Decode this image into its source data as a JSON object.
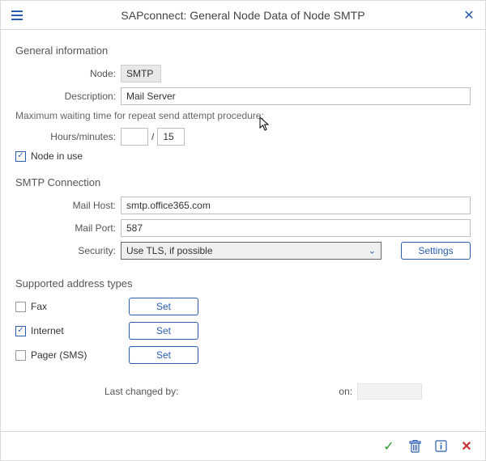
{
  "titlebar": {
    "title": "SAPconnect: General Node Data of Node SMTP"
  },
  "general": {
    "heading": "General information",
    "labels": {
      "node": "Node:",
      "description": "Description:",
      "wait_note": "Maximum waiting time for repeat send attempt procedure:",
      "hours_minutes": "Hours/minutes:",
      "separator": "/",
      "node_in_use": "Node in use"
    },
    "values": {
      "node": "SMTP",
      "description": "Mail Server",
      "hours": "",
      "minutes": "15"
    },
    "node_in_use_checked": true
  },
  "smtp": {
    "heading": "SMTP Connection",
    "labels": {
      "mail_host": "Mail Host:",
      "mail_port": "Mail Port:",
      "security": "Security:",
      "settings_btn": "Settings"
    },
    "values": {
      "mail_host": "smtp.office365.com",
      "mail_port": "587",
      "security_selected": "Use TLS, if possible"
    }
  },
  "address_types": {
    "heading": "Supported address types",
    "set_label": "Set",
    "rows": [
      {
        "key": "fax",
        "label": "Fax",
        "checked": false
      },
      {
        "key": "internet",
        "label": "Internet",
        "checked": true
      },
      {
        "key": "pager",
        "label": "Pager (SMS)",
        "checked": false
      }
    ]
  },
  "last_changed": {
    "label_by": "Last changed by:",
    "value_by": "",
    "label_on": "on:",
    "value_on": ""
  },
  "footer": {
    "ok": "✓",
    "cancel": "✕"
  }
}
